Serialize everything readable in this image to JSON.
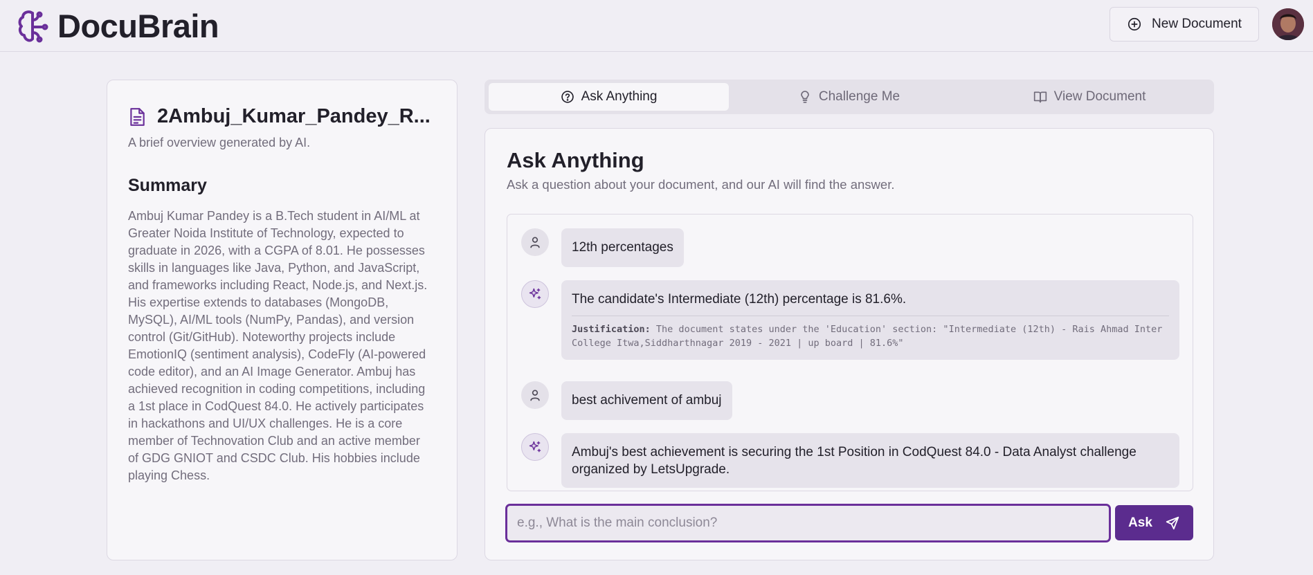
{
  "app": {
    "brand": "DocuBrain",
    "accent_color": "#5b2c8e",
    "brand_icon": "brain-icon"
  },
  "header": {
    "new_document_label": "New Document",
    "new_document_icon": "plus-circle-icon"
  },
  "document": {
    "title": "2Ambuj_Kumar_Pandey_R...",
    "subtitle": "A brief overview generated by AI.",
    "summary_heading": "Summary",
    "summary_text": "Ambuj Kumar Pandey is a B.Tech student in AI/ML at Greater Noida Institute of Technology, expected to graduate in 2026, with a CGPA of 8.01. He possesses skills in languages like Java, Python, and JavaScript, and frameworks including React, Node.js, and Next.js. His expertise extends to databases (MongoDB, MySQL), AI/ML tools (NumPy, Pandas), and version control (Git/GitHub). Noteworthy projects include EmotionIQ (sentiment analysis), CodeFly (AI-powered code editor), and an AI Image Generator. Ambuj has achieved recognition in coding competitions, including a 1st place in CodQuest 84.0. He actively participates in hackathons and UI/UX challenges. He is a core member of Technovation Club and an active member of GDG GNIOT and CSDC Club. His hobbies include playing Chess."
  },
  "tabs": [
    {
      "label": "Ask Anything",
      "icon": "help-circle-icon",
      "active": true
    },
    {
      "label": "Challenge Me",
      "icon": "lightbulb-icon",
      "active": false
    },
    {
      "label": "View Document",
      "icon": "book-open-icon",
      "active": false
    }
  ],
  "ask_panel": {
    "title": "Ask Anything",
    "subtitle": "Ask a question about your document, and our AI will find the answer.",
    "messages": [
      {
        "role": "user",
        "text": "12th percentages"
      },
      {
        "role": "ai",
        "text": "The candidate's Intermediate (12th) percentage is 81.6%.",
        "justification_label": "Justification:",
        "justification": " The document states under the 'Education' section: \"Intermediate (12th) - Rais Ahmad Inter College Itwa,Siddharthnagar 2019 - 2021 | up board | 81.6%\""
      },
      {
        "role": "user",
        "text": "best achivement of ambuj"
      },
      {
        "role": "ai",
        "text": "Ambuj's best achievement is securing the 1st Position in CodQuest 84.0 - Data Analyst challenge organized by LetsUpgrade."
      }
    ],
    "input_placeholder": "e.g., What is the main conclusion?",
    "input_value": "",
    "ask_label": "Ask"
  }
}
